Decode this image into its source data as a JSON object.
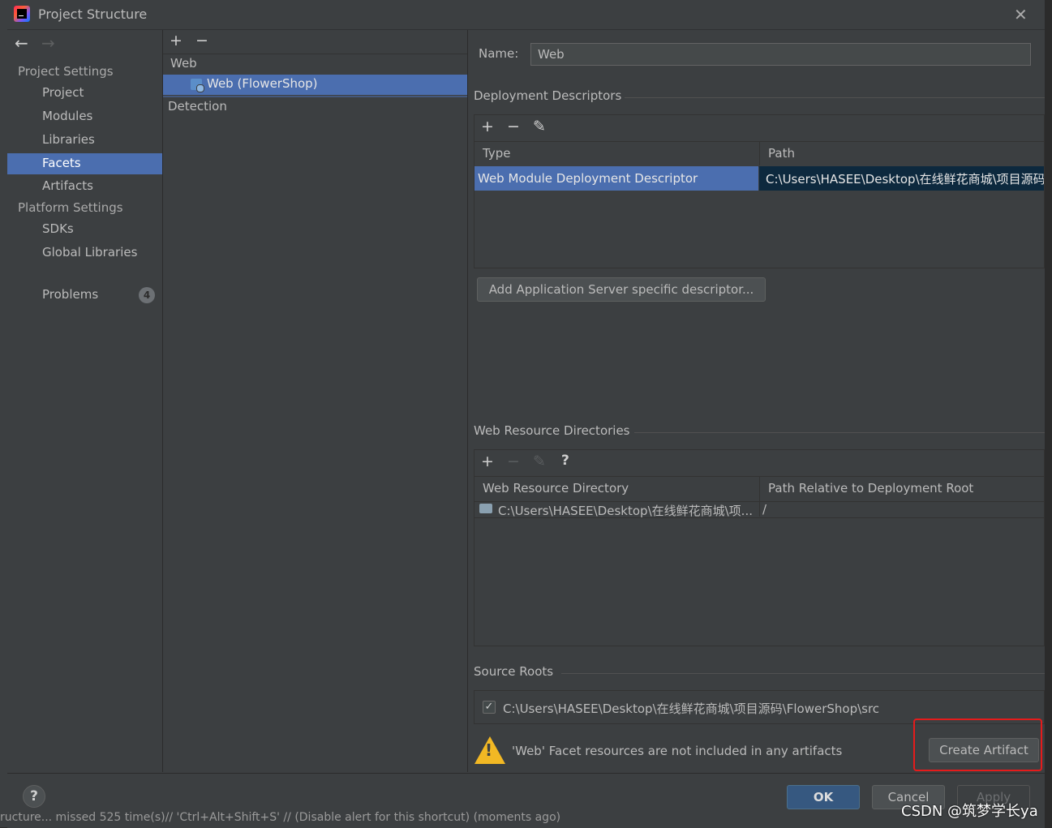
{
  "window": {
    "title": "Project Structure"
  },
  "nav": {
    "back": "←",
    "forward": "→",
    "project_settings": "Project Settings",
    "items": [
      "Project",
      "Modules",
      "Libraries",
      "Facets",
      "Artifacts"
    ],
    "platform_settings": "Platform Settings",
    "platform_items": [
      "SDKs",
      "Global Libraries"
    ],
    "problems": "Problems",
    "problems_count": "4"
  },
  "tree": {
    "add": "+",
    "remove": "−",
    "group": "Web",
    "selected": "Web (FlowerShop)",
    "detection": "Detection"
  },
  "facet": {
    "name_label": "Name:",
    "name_value": "Web",
    "deployment": {
      "title": "Deployment Descriptors",
      "col_type": "Type",
      "col_path": "Path",
      "row_type": "Web Module Deployment Descriptor",
      "row_path": "C:\\Users\\HASEE\\Desktop\\在线鲜花商城\\项目源码",
      "add_server_btn": "Add Application Server specific descriptor..."
    },
    "resources": {
      "title": "Web Resource Directories",
      "help": "?",
      "col_dir": "Web Resource Directory",
      "col_rel": "Path Relative to Deployment Root",
      "row_dir": "C:\\Users\\HASEE\\Desktop\\在线鲜花商城\\项...",
      "row_rel": "/"
    },
    "source_roots": {
      "title": "Source Roots",
      "path": "C:\\Users\\HASEE\\Desktop\\在线鲜花商城\\项目源码\\FlowerShop\\src",
      "checked": true
    },
    "warning": "'Web' Facet resources are not included in any artifacts",
    "create_artifact": "Create Artifact"
  },
  "footer": {
    "help": "?",
    "ok": "OK",
    "cancel": "Cancel",
    "apply": "Apply"
  },
  "status_bar": "ructure... missed 525 time(s)// 'Ctrl+Alt+Shift+S' // (Disable alert for this shortcut) (moments ago)",
  "watermark": "CSDN @筑梦学长ya",
  "colors": {
    "selection": "#4b6eaf",
    "ok_button": "#365880",
    "highlight_box": "#e51b1b",
    "warning": "#f2b824"
  }
}
